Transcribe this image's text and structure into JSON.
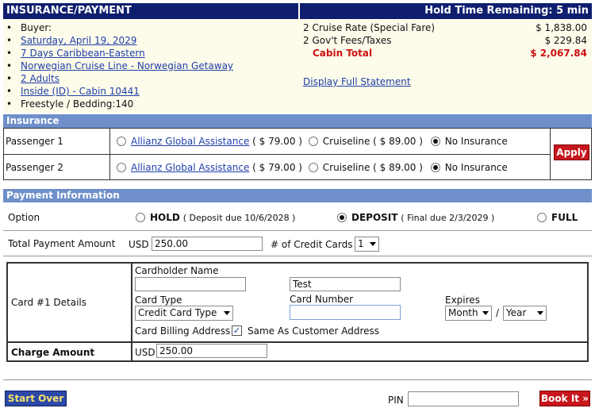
{
  "header": {
    "title": "INSURANCE/PAYMENT",
    "hold_time": "Hold Time Remaining: 5 min"
  },
  "summary": {
    "items": [
      {
        "text": "Buyer:",
        "link": false
      },
      {
        "text": "Saturday, April 19, 2029",
        "link": true
      },
      {
        "text": "7 Days Caribbean-Eastern",
        "link": true
      },
      {
        "text": "Norwegian Cruise Line - Norwegian Getaway",
        "link": true
      },
      {
        "text": "2 Adults",
        "link": true
      },
      {
        "text": "Inside (ID) - Cabin 10441",
        "link": true
      },
      {
        "text": "Freestyle / Bedding:140",
        "link": false
      }
    ],
    "fees": [
      {
        "label": "2 Cruise Rate (Special Fare)",
        "amount": "$ 1,838.00"
      },
      {
        "label": "2 Gov't Fees/Taxes",
        "amount": "$ 229.84"
      }
    ],
    "total_label": "Cabin Total",
    "total_amount": "$ 2,067.84",
    "statement_link": "Display Full Statement"
  },
  "insurance": {
    "header": "Insurance",
    "apply_label": "Apply",
    "rows": [
      {
        "passenger": "Passenger 1",
        "allianz": "Allianz Global Assistance",
        "allianz_price": "( $ 79.00 )",
        "cruiseline": "Cruiseline ( $ 89.00 )",
        "none": "No Insurance",
        "selected": "none"
      },
      {
        "passenger": "Passenger 2",
        "allianz": "Allianz Global Assistance",
        "allianz_price": "( $ 79.00 )",
        "cruiseline": "Cruiseline ( $ 89.00 )",
        "none": "No Insurance",
        "selected": "none"
      }
    ]
  },
  "payment": {
    "header": "Payment Information",
    "option_label": "Option",
    "hold": {
      "label": "HOLD",
      "note": "( Deposit due 10/6/2028 )"
    },
    "deposit": {
      "label": "DEPOSIT",
      "note": "( Final due 2/3/2029 )"
    },
    "full": {
      "label": "FULL"
    },
    "selected_option": "deposit",
    "total_label": "Total Payment Amount",
    "currency": "USD",
    "total_value": "250.00",
    "cards_label": "# of Credit Cards",
    "cards_value": "1"
  },
  "card": {
    "section_label": "Card #1 Details",
    "cardholder_label": "Cardholder Name",
    "first_name": "",
    "last_name": "Test",
    "card_type_label": "Card Type",
    "card_type_value": "Credit Card Type",
    "card_number_label": "Card Number",
    "card_number_value": "",
    "expires_label": "Expires",
    "month_value": "Month",
    "slash": "/",
    "year_value": "Year",
    "billing_label": "Card Billing Address",
    "same_label": "Same As Customer Address",
    "same_checked": true,
    "charge_label": "Charge Amount",
    "charge_currency": "USD",
    "charge_value": "250.00"
  },
  "footer": {
    "start_over": "Start Over",
    "pin_label": "PIN",
    "pin_value": "",
    "book_label": "Book It »"
  }
}
